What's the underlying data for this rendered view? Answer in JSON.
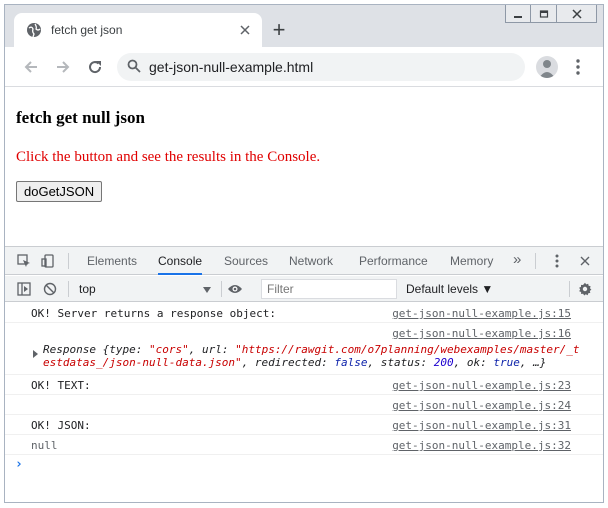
{
  "browser": {
    "tab_title": "fetch get json",
    "new_tab_symbol": "+",
    "address": "get-json-null-example.html",
    "icons": [
      "globe-icon",
      "close-icon",
      "back-icon",
      "forward-icon",
      "reload-icon",
      "search-icon",
      "profile-icon",
      "more-menu-icon",
      "minimize-icon",
      "restore-icon",
      "window-close-icon"
    ]
  },
  "page": {
    "heading": "fetch get null json",
    "hint": "Click the button and see the results in the Console.",
    "button_label": "doGetJSON",
    "hint_color": "#e00000"
  },
  "devtools": {
    "tabs": [
      "Elements",
      "Console",
      "Sources",
      "Network",
      "Performance",
      "Memory"
    ],
    "more_tabs": "»",
    "active_tab": "Console",
    "context": "top",
    "filter_placeholder": "Filter",
    "levels": "Default levels ▼",
    "accent": "#1a73e8"
  },
  "console": {
    "messages": [
      {
        "text": "OK! Server returns a response object:",
        "source": "get-json-null-example.js:15"
      },
      {
        "text": "",
        "source": "get-json-null-example.js:16"
      },
      {
        "text": "OK! TEXT:",
        "source": "get-json-null-example.js:23"
      },
      {
        "text": "",
        "source": "get-json-null-example.js:24"
      },
      {
        "text": "OK! JSON:",
        "source": "get-json-null-example.js:31"
      },
      {
        "text": "null",
        "source": "get-json-null-example.js:32"
      }
    ],
    "response": {
      "prefix": "Response {type: ",
      "type": "\"cors\"",
      "sep1": ", url: ",
      "url_a": "\"https://rawgit.com/o7planning/webexamples/master/_t",
      "url_b": "estdatas_/json-null-data.json\"",
      "sep2": ", redirected: ",
      "redirected": "false",
      "sep3": ", status: ",
      "status": "200",
      "sep4": ", ok: ",
      "ok": "true",
      "suffix": ", …}"
    },
    "prompt": "›"
  }
}
